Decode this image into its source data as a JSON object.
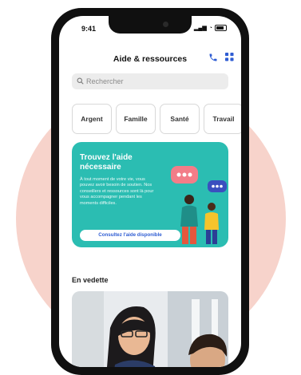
{
  "status": {
    "time": "9:41",
    "signal": "… ▾"
  },
  "header": {
    "title": "Aide & ressources",
    "phone_icon": "phone-icon",
    "grid_icon": "grid-icon"
  },
  "search": {
    "placeholder": "Rechercher"
  },
  "chips": [
    {
      "label": "Argent"
    },
    {
      "label": "Famille"
    },
    {
      "label": "Santé"
    },
    {
      "label": "Travail"
    }
  ],
  "promo": {
    "title": "Trouvez l'aide nécessaire",
    "body": "À tout moment de votre vie, vous pouvez avoir besoin de soutien. Nos conseillers et ressources sont là pour vous accompagner pendant les moments difficiles.",
    "button_label": "Consultez l'aide disponible"
  },
  "news": {
    "title": "En vedette"
  },
  "colors": {
    "accent": "#2f5dd3",
    "card": "#2bbdb2",
    "background_circle": "#f7d3cb",
    "bubble_pink": "#f27d88",
    "bubble_blue": "#3a4fbf"
  }
}
